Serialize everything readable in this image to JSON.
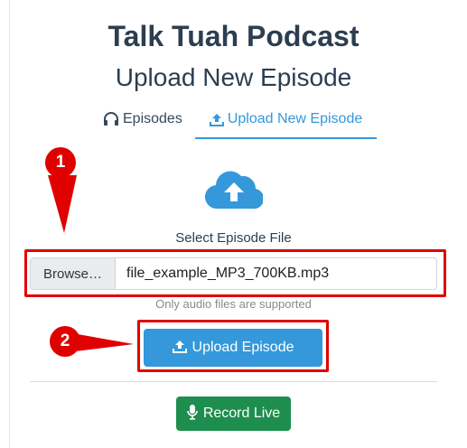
{
  "header": {
    "title": "Talk Tuah Podcast",
    "subtitle": "Upload New Episode"
  },
  "tabs": [
    {
      "label": "Episodes",
      "icon": "headphones-icon",
      "active": false
    },
    {
      "label": "Upload New Episode",
      "icon": "upload-icon",
      "active": true
    }
  ],
  "upload": {
    "cloud_icon": "cloud-upload-icon",
    "select_label": "Select Episode File",
    "browse_label": "Browse…",
    "file_name": "file_example_MP3_700KB.mp3",
    "hint": "Only audio files are supported",
    "upload_button": "Upload Episode"
  },
  "record": {
    "button": "Record Live",
    "icon": "microphone-icon"
  },
  "annotations": {
    "step1": "1",
    "step2": "2",
    "color": "#e00000"
  },
  "colors": {
    "primary": "#3498db",
    "success": "#1e8e4e",
    "heading": "#2c3e50"
  }
}
